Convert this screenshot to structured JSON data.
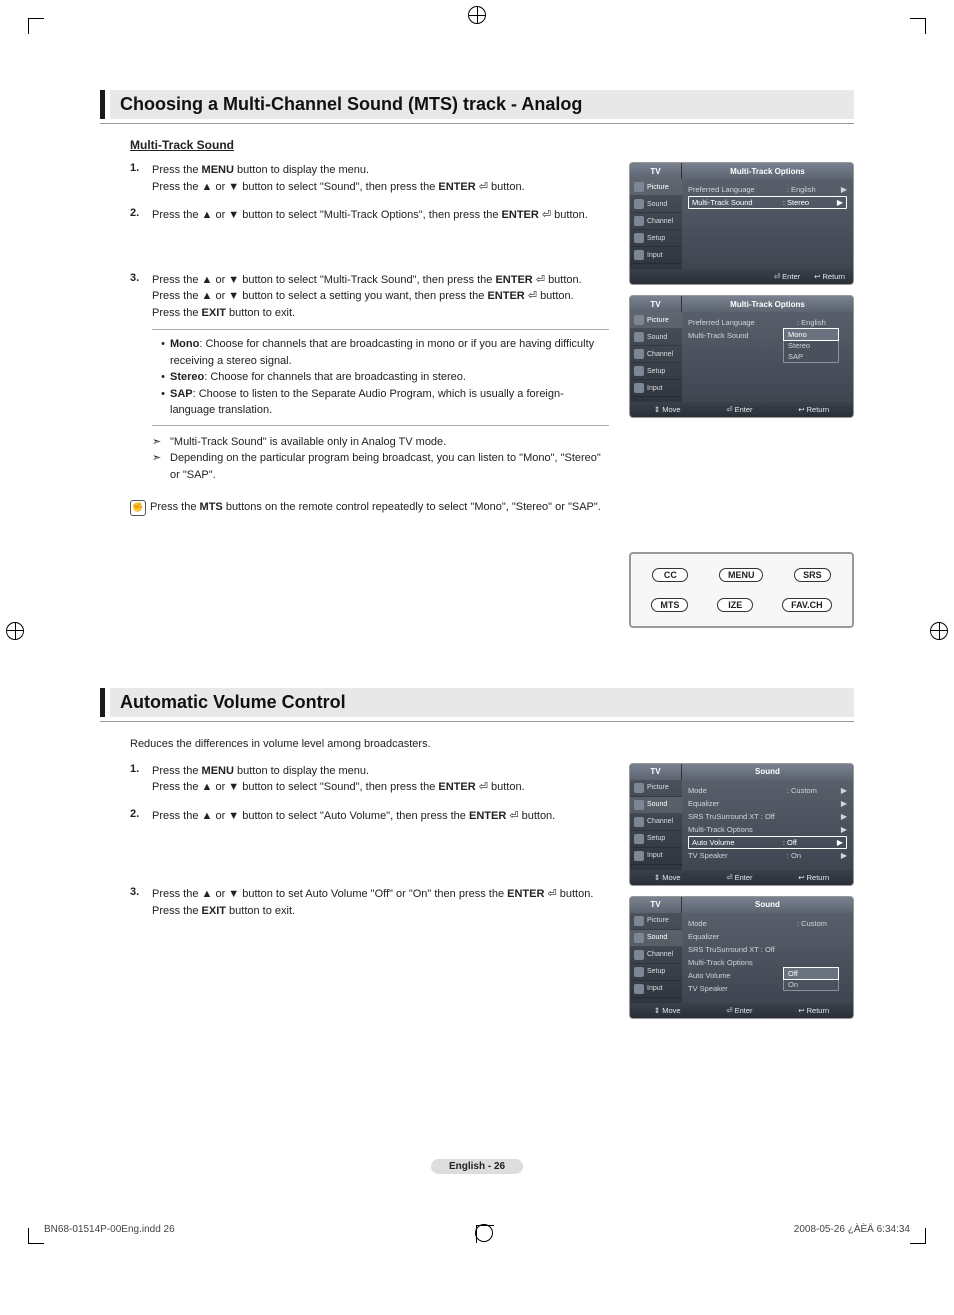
{
  "section1": {
    "title": "Choosing a Multi-Channel Sound (MTS) track - Analog",
    "subheading": "Multi-Track Sound",
    "steps": {
      "s1": "Press the MENU button to display the menu.\nPress the ▲ or ▼ button to select \"Sound\", then press the ENTER ⏎ button.",
      "s2": "Press the ▲ or ▼ button to select \"Multi-Track Options\", then press the ENTER ⏎ button.",
      "s3a": "Press the ▲ or ▼ button to select \"Multi-Track Sound\", then press the ENTER ⏎ button.",
      "s3b": "Press the ▲ or ▼ button to select a setting you want, then press the ENTER ⏎ button.",
      "s3c": "Press the EXIT button to exit."
    },
    "bullets": {
      "mono": "Mono: Choose for channels that are broadcasting in mono or if you are having difficulty receiving a stereo signal.",
      "stereo": "Stereo: Choose for channels that are broadcasting in stereo.",
      "sap": "SAP: Choose to listen to the Separate Audio Program, which is usually a foreign-language translation."
    },
    "notes": {
      "n1": "\"Multi-Track Sound\" is available only in Analog TV mode.",
      "n2": "Depending on the particular program being broadcast, you can listen to \"Mono\", \"Stereo\" or \"SAP\"."
    },
    "remote_tip": "Press the MTS buttons on the remote control repeatedly to select \"Mono\", \"Stereo\" or \"SAP\"."
  },
  "section2": {
    "title": "Automatic Volume Control",
    "intro": "Reduces the differences in volume level among broadcasters.",
    "steps": {
      "s1": "Press the MENU button to display the menu.\nPress the ▲ or ▼ button to select \"Sound\", then press the ENTER ⏎ button.",
      "s2": "Press the ▲ or ▼ button to select \"Auto Volume\", then press the ENTER ⏎ button.",
      "s3a": "Press the ▲ or ▼ button to set Auto Volume \"Off\" or \"On\" then press the ENTER ⏎ button.",
      "s3b": "Press the EXIT button to exit."
    }
  },
  "osd": {
    "tv": "TV",
    "side": {
      "picture": "Picture",
      "sound": "Sound",
      "channel": "Channel",
      "setup": "Setup",
      "input": "Input"
    },
    "mt_title": "Multi-Track Options",
    "pref_lang_label": "Preferred Language",
    "pref_lang_value": ": English",
    "mt_sound_label": "Multi-Track Sound",
    "mt_sound_value": ": Stereo",
    "dropdown": {
      "mono": "Mono",
      "stereo": "Stereo",
      "sap": "SAP"
    },
    "sound_title": "Sound",
    "mode_label": "Mode",
    "mode_value": ": Custom",
    "equalizer": "Equalizer",
    "srs": "SRS TruSurround XT : Off",
    "mt_options": "Multi-Track Options",
    "auto_vol_label": "Auto Volume",
    "auto_vol_value": ": Off",
    "tv_speaker_label": "TV Speaker",
    "tv_speaker_value": ": On",
    "av_dropdown": {
      "off": "Off",
      "on": "On"
    },
    "footer": {
      "enter": "⏎ Enter",
      "return": "↩ Return",
      "move": "⇕ Move"
    }
  },
  "remote": {
    "cc": "CC",
    "menu": "MENU",
    "srs": "SRS",
    "mts": "MTS",
    "size": "IZE",
    "favch": "FAV.CH"
  },
  "page_footer": "English - 26",
  "print": {
    "left": "BN68-01514P-00Eng.indd   26",
    "right": "2008-05-26   ¿ÀÈÄ 6:34:34"
  }
}
